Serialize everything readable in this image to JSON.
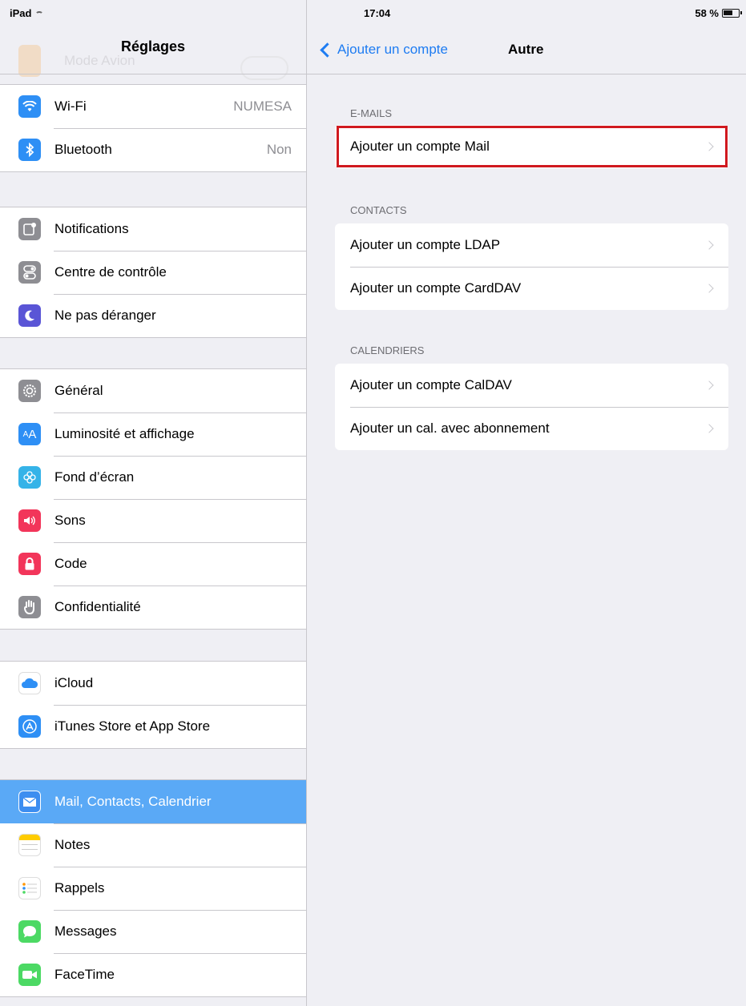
{
  "status_bar": {
    "device": "iPad",
    "time": "17:04",
    "battery": "58 %"
  },
  "sidebar": {
    "title": "Réglages",
    "peek_label": "Mode Avion",
    "groups": [
      [
        {
          "label": "Wi-Fi",
          "value": "NUMESA",
          "icon": "wifi-icon",
          "color": "#2e8ff5"
        },
        {
          "label": "Bluetooth",
          "value": "Non",
          "icon": "bluetooth-icon",
          "color": "#2e8ff5"
        }
      ],
      [
        {
          "label": "Notifications",
          "icon": "notifications-icon",
          "color": "#8e8e93"
        },
        {
          "label": "Centre de contrôle",
          "icon": "control-center-icon",
          "color": "#8e8e93"
        },
        {
          "label": "Ne pas déranger",
          "icon": "moon-icon",
          "color": "#5a55d6"
        }
      ],
      [
        {
          "label": "Général",
          "icon": "gear-icon",
          "color": "#8e8e93"
        },
        {
          "label": "Luminosité et affichage",
          "icon": "brightness-icon",
          "color": "#2e8ff5"
        },
        {
          "label": "Fond d’écran",
          "icon": "wallpaper-icon",
          "color": "#35b3e8"
        },
        {
          "label": "Sons",
          "icon": "speaker-icon",
          "color": "#f2355a"
        },
        {
          "label": "Code",
          "icon": "lock-icon",
          "color": "#f2355a"
        },
        {
          "label": "Confidentialité",
          "icon": "hand-icon",
          "color": "#8e8e93"
        }
      ],
      [
        {
          "label": "iCloud",
          "icon": "cloud-icon",
          "color": "#ffffff"
        },
        {
          "label": "iTunes Store et App Store",
          "icon": "app-store-icon",
          "color": "#2e8ff5"
        }
      ],
      [
        {
          "label": "Mail, Contacts, Calendrier",
          "icon": "mail-icon",
          "color": "#3d8ef0",
          "selected": true
        },
        {
          "label": "Notes",
          "icon": "notes-icon",
          "color": "#ffffff"
        },
        {
          "label": "Rappels",
          "icon": "reminders-icon",
          "color": "#ffffff"
        },
        {
          "label": "Messages",
          "icon": "messages-icon",
          "color": "#4cd964"
        },
        {
          "label": "FaceTime",
          "icon": "facetime-icon",
          "color": "#4cd964"
        }
      ]
    ]
  },
  "detail": {
    "back_label": "Ajouter un compte",
    "title": "Autre",
    "sections": [
      {
        "header": "E-MAILS",
        "rows": [
          "Ajouter un compte Mail"
        ]
      },
      {
        "header": "CONTACTS",
        "rows": [
          "Ajouter un compte LDAP",
          "Ajouter un compte CardDAV"
        ]
      },
      {
        "header": "CALENDRIERS",
        "rows": [
          "Ajouter un compte CalDAV",
          "Ajouter un cal. avec abonnement"
        ]
      }
    ],
    "highlight_color": "#d0191f"
  }
}
